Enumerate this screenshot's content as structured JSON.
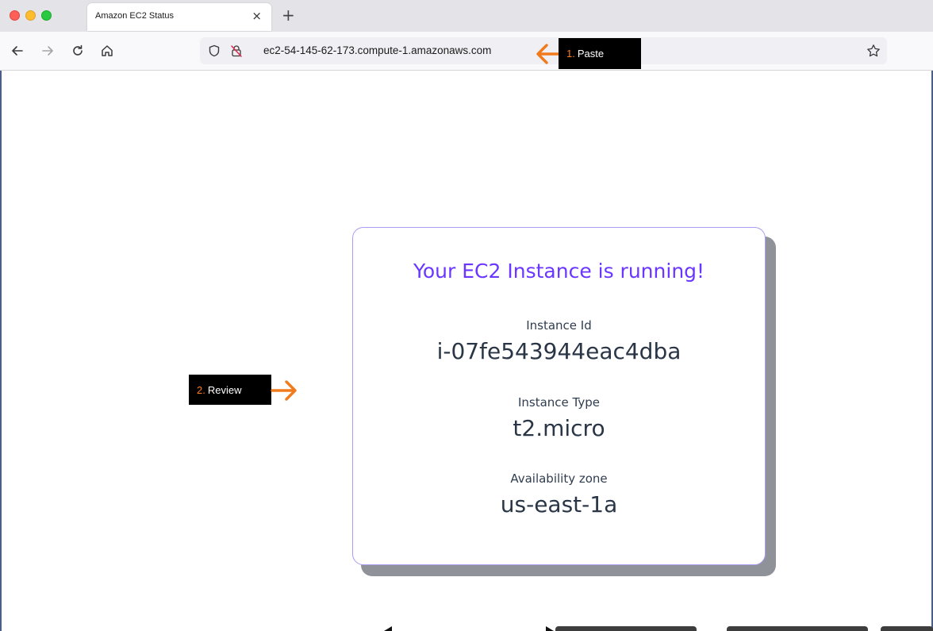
{
  "browser": {
    "tab_title": "Amazon EC2 Status",
    "tab_close": "×",
    "new_tab": "+",
    "url": "ec2-54-145-62-173.compute-1.amazonaws.com"
  },
  "annotations": {
    "paste_num": "1.",
    "paste_label": "Paste",
    "review_num": "2.",
    "review_label": "Review",
    "accent_color": "#f07a1c"
  },
  "card": {
    "title": "Your EC2 Instance is running!",
    "title_color": "#6b36ff",
    "fields": [
      {
        "label": "Instance Id",
        "value": "i-07fe543944eac4dba"
      },
      {
        "label": "Instance Type",
        "value": "t2.micro"
      },
      {
        "label": "Availability zone",
        "value": "us-east-1a"
      }
    ]
  }
}
